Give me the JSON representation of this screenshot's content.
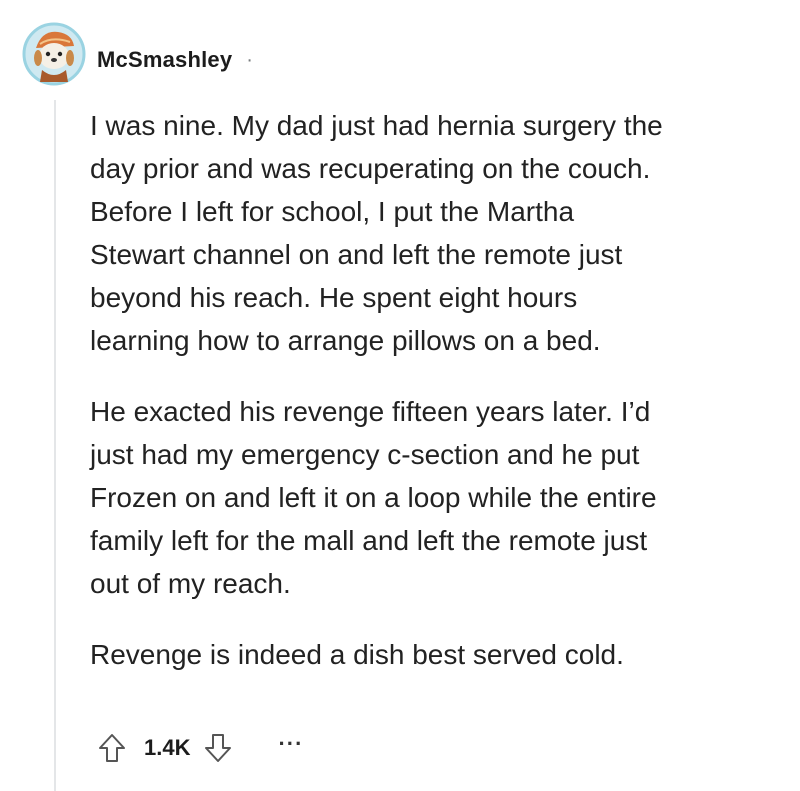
{
  "comment": {
    "author": "McSmashley",
    "separator": "·",
    "paragraphs": [
      "I was nine. My dad just had hernia surgery the\nday prior and was recuperating on the couch.\nBefore I left for school, I put the Martha\nStewart channel on and left the remote just\nbeyond his reach. He spent eight hours\nlearning how to arrange pillows on a bed.",
      "He exacted his revenge fifteen years later. I’d\njust had my emergency c-section and he put\nFrozen on and left it on a loop while the entire\nfamily left for the mall and left the remote just\nout of my reach.",
      "Revenge is indeed a dish best served cold."
    ],
    "score": "1.4K",
    "more_label": "···"
  },
  "icons": {
    "upvote": "upvote-arrow-icon",
    "downvote": "downvote-arrow-icon",
    "more": "more-options-icon"
  },
  "colors": {
    "text": "#1c1c1c",
    "muted": "#787c7e",
    "thread_line": "#e4e6e8",
    "avatar_ring": "#9ad3e2"
  }
}
